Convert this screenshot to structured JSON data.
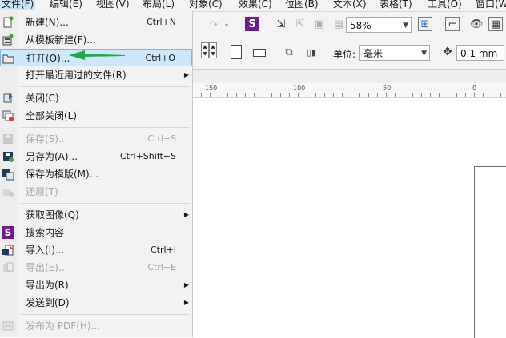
{
  "menubar": [
    {
      "id": "file",
      "label": "文件(F)",
      "active": true
    },
    {
      "id": "edit",
      "label": "编辑(E)"
    },
    {
      "id": "view",
      "label": "视图(V)"
    },
    {
      "id": "layout",
      "label": "布局(L)"
    },
    {
      "id": "object",
      "label": "对象(C)"
    },
    {
      "id": "effects",
      "label": "效果(C)"
    },
    {
      "id": "bitmap",
      "label": "位图(B)"
    },
    {
      "id": "text",
      "label": "文本(X)"
    },
    {
      "id": "table",
      "label": "表格(T)"
    },
    {
      "id": "tools",
      "label": "工具(O)"
    },
    {
      "id": "window",
      "label": "窗口(W)"
    }
  ],
  "toolbar": {
    "zoom_value": "58%",
    "unit_label": "单位:",
    "unit_value": "毫米",
    "nudge_value": "0.1 mm"
  },
  "ruler": {
    "labels": [
      "150",
      "100",
      "50",
      "0"
    ]
  },
  "file_menu": {
    "items": [
      {
        "label": "新建(N)...",
        "shortcut": "Ctrl+N",
        "icon": "new-document-icon"
      },
      {
        "label": "从模板新建(F)...",
        "shortcut": "",
        "icon": "new-from-template-icon"
      },
      {
        "label": "打开(O)...",
        "shortcut": "Ctrl+O",
        "icon": "open-folder-icon",
        "highlight": true
      },
      {
        "label": "打开最近用过的文件(R)",
        "shortcut": "",
        "icon": "",
        "submenu": true
      },
      {
        "label": "关闭(C)",
        "shortcut": "",
        "icon": "close-document-icon"
      },
      {
        "label": "全部关闭(L)",
        "shortcut": "",
        "icon": "close-all-icon"
      },
      {
        "label": "保存(S)...",
        "shortcut": "Ctrl+S",
        "icon": "save-icon",
        "disabled": true
      },
      {
        "label": "另存为(A)...",
        "shortcut": "Ctrl+Shift+S",
        "icon": "save-as-icon"
      },
      {
        "label": "保存为模版(M)...",
        "shortcut": "",
        "icon": "save-template-icon"
      },
      {
        "label": "还原(T)",
        "shortcut": "",
        "icon": "revert-icon",
        "disabled": true
      },
      {
        "label": "获取图像(Q)",
        "shortcut": "",
        "icon": "",
        "submenu": true
      },
      {
        "label": "搜索内容",
        "shortcut": "",
        "icon": "search-content-icon"
      },
      {
        "label": "导入(I)...",
        "shortcut": "Ctrl+I",
        "icon": "import-icon"
      },
      {
        "label": "导出(E)...",
        "shortcut": "Ctrl+E",
        "icon": "export-icon",
        "disabled": true
      },
      {
        "label": "导出为(R)",
        "shortcut": "",
        "icon": "",
        "submenu": true
      },
      {
        "label": "发送到(D)",
        "shortcut": "",
        "icon": "",
        "submenu": true
      },
      {
        "label": "发布为 PDF(H)...",
        "shortcut": "",
        "icon": "publish-pdf-icon",
        "disabled": true
      }
    ]
  },
  "colors": {
    "highlight_bg": "#cde8fb",
    "annotation_arrow": "#22a84a",
    "brand_purple": "#6a1f8c"
  }
}
